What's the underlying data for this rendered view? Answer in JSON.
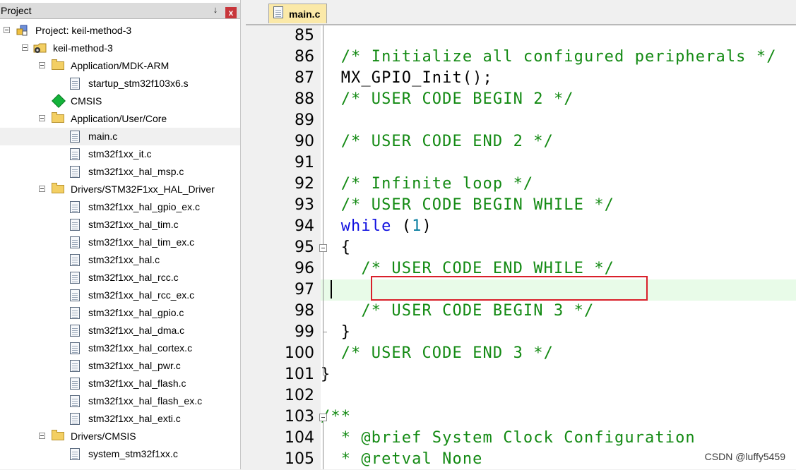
{
  "panel": {
    "title": "Project",
    "pin_glyph": "↓",
    "close_glyph": "x"
  },
  "tree": [
    {
      "label": "Project: keil-method-3",
      "icon": "project-icon",
      "level": 0,
      "toggle": true
    },
    {
      "label": "keil-method-3",
      "icon": "target-folder-icon",
      "level": 1,
      "toggle": true
    },
    {
      "label": "Application/MDK-ARM",
      "icon": "folder-icon",
      "level": 2,
      "toggle": true
    },
    {
      "label": "startup_stm32f103x6.s",
      "icon": "file-icon",
      "level": 3
    },
    {
      "label": "CMSIS",
      "icon": "cmsis-component-icon",
      "level": 2
    },
    {
      "label": "Application/User/Core",
      "icon": "folder-icon",
      "level": 2,
      "toggle": true
    },
    {
      "label": "main.c",
      "icon": "file-icon",
      "level": 3,
      "selected": true
    },
    {
      "label": "stm32f1xx_it.c",
      "icon": "file-icon",
      "level": 3
    },
    {
      "label": "stm32f1xx_hal_msp.c",
      "icon": "file-icon",
      "level": 3
    },
    {
      "label": "Drivers/STM32F1xx_HAL_Driver",
      "icon": "folder-icon",
      "level": 2,
      "toggle": true
    },
    {
      "label": "stm32f1xx_hal_gpio_ex.c",
      "icon": "file-icon",
      "level": 3
    },
    {
      "label": "stm32f1xx_hal_tim.c",
      "icon": "file-icon",
      "level": 3
    },
    {
      "label": "stm32f1xx_hal_tim_ex.c",
      "icon": "file-icon",
      "level": 3
    },
    {
      "label": "stm32f1xx_hal.c",
      "icon": "file-icon",
      "level": 3
    },
    {
      "label": "stm32f1xx_hal_rcc.c",
      "icon": "file-icon",
      "level": 3
    },
    {
      "label": "stm32f1xx_hal_rcc_ex.c",
      "icon": "file-icon",
      "level": 3
    },
    {
      "label": "stm32f1xx_hal_gpio.c",
      "icon": "file-icon",
      "level": 3
    },
    {
      "label": "stm32f1xx_hal_dma.c",
      "icon": "file-icon",
      "level": 3
    },
    {
      "label": "stm32f1xx_hal_cortex.c",
      "icon": "file-icon",
      "level": 3
    },
    {
      "label": "stm32f1xx_hal_pwr.c",
      "icon": "file-icon",
      "level": 3
    },
    {
      "label": "stm32f1xx_hal_flash.c",
      "icon": "file-icon",
      "level": 3
    },
    {
      "label": "stm32f1xx_hal_flash_ex.c",
      "icon": "file-icon",
      "level": 3
    },
    {
      "label": "stm32f1xx_hal_exti.c",
      "icon": "file-icon",
      "level": 3
    },
    {
      "label": "Drivers/CMSIS",
      "icon": "folder-icon",
      "level": 2,
      "toggle": true
    },
    {
      "label": "system_stm32f1xx.c",
      "icon": "file-icon",
      "level": 3
    }
  ],
  "editor": {
    "tab_label": "main.c",
    "current_line": "97",
    "lines": [
      {
        "n": "85",
        "tokens": []
      },
      {
        "n": "86",
        "tokens": [
          {
            "t": "  "
          },
          {
            "t": "/* Initialize all configured peripherals */",
            "c": "cm"
          }
        ]
      },
      {
        "n": "87",
        "tokens": [
          {
            "t": "  MX_GPIO_Init();"
          }
        ]
      },
      {
        "n": "88",
        "tokens": [
          {
            "t": "  "
          },
          {
            "t": "/* USER CODE BEGIN 2 */",
            "c": "cm"
          }
        ]
      },
      {
        "n": "89",
        "tokens": []
      },
      {
        "n": "90",
        "tokens": [
          {
            "t": "  "
          },
          {
            "t": "/* USER CODE END 2 */",
            "c": "cm"
          }
        ]
      },
      {
        "n": "91",
        "tokens": []
      },
      {
        "n": "92",
        "tokens": [
          {
            "t": "  "
          },
          {
            "t": "/* Infinite loop */",
            "c": "cm"
          }
        ]
      },
      {
        "n": "93",
        "tokens": [
          {
            "t": "  "
          },
          {
            "t": "/* USER CODE BEGIN WHILE */",
            "c": "cm"
          }
        ]
      },
      {
        "n": "94",
        "tokens": [
          {
            "t": "  "
          },
          {
            "t": "while",
            "c": "kw"
          },
          {
            "t": " ("
          },
          {
            "t": "1",
            "c": "num"
          },
          {
            "t": ")"
          }
        ]
      },
      {
        "n": "95",
        "tokens": [
          {
            "t": "  {"
          }
        ]
      },
      {
        "n": "96",
        "tokens": [
          {
            "t": "    "
          },
          {
            "t": "/* USER CODE END WHILE */",
            "c": "cm"
          }
        ]
      },
      {
        "n": "97",
        "tokens": []
      },
      {
        "n": "98",
        "tokens": [
          {
            "t": "    "
          },
          {
            "t": "/* USER CODE BEGIN 3 */",
            "c": "cm"
          }
        ]
      },
      {
        "n": "99",
        "tokens": [
          {
            "t": "  }"
          }
        ]
      },
      {
        "n": "100",
        "tokens": [
          {
            "t": "  "
          },
          {
            "t": "/* USER CODE END 3 */",
            "c": "cm"
          }
        ]
      },
      {
        "n": "101",
        "tokens": [
          {
            "t": "}"
          }
        ]
      },
      {
        "n": "102",
        "tokens": []
      },
      {
        "n": "103",
        "tokens": [
          {
            "t": "/**",
            "c": "cm"
          }
        ]
      },
      {
        "n": "104",
        "tokens": [
          {
            "t": "  * @brief System Clock Configuration",
            "c": "cm"
          }
        ]
      },
      {
        "n": "105",
        "tokens": [
          {
            "t": "  * @retval None",
            "c": "cm"
          }
        ]
      }
    ]
  },
  "watermark": "CSDN @luffy5459",
  "colors": {
    "comment": "#138a13",
    "keyword": "#1010e0",
    "number": "#0a7ea0",
    "current_line_bg": "#e8fbe8",
    "highlight_box": "#d9202a",
    "tab_bg": "#fbe9a8"
  }
}
